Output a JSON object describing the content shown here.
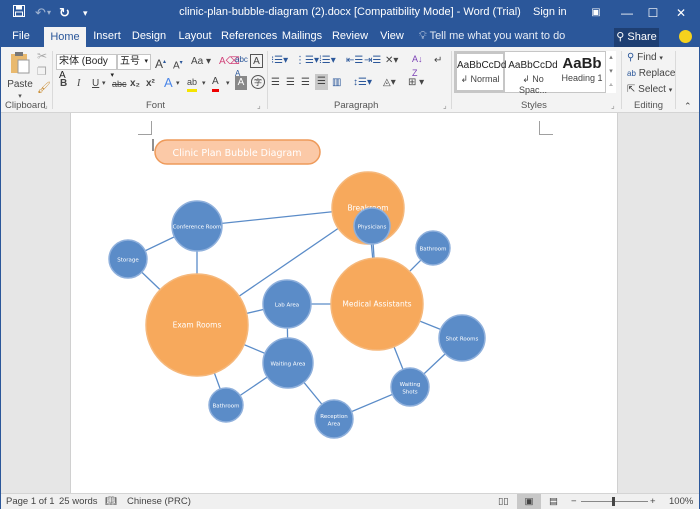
{
  "titlebar": {
    "title": "clinic-plan-bubble-diagram (2).docx [Compatibility Mode]  -  Word (Trial)",
    "sign_in": "Sign in",
    "quick_access": [
      "save-icon",
      "undo-icon",
      "redo-icon",
      "customize-icon"
    ],
    "window_controls": [
      "ribbon-display-icon",
      "minimize-icon",
      "maximize-icon",
      "close-icon"
    ]
  },
  "tabs": [
    {
      "label": "File"
    },
    {
      "label": "Home",
      "active": true
    },
    {
      "label": "Insert"
    },
    {
      "label": "Design"
    },
    {
      "label": "Layout"
    },
    {
      "label": "References"
    },
    {
      "label": "Mailings"
    },
    {
      "label": "Review"
    },
    {
      "label": "View"
    }
  ],
  "tell_me": "Tell me what you want to do",
  "share_label": "Share",
  "ribbon": {
    "clipboard": {
      "label": "Clipboard",
      "paste": "Paste"
    },
    "font": {
      "label": "Font",
      "font_name": "宋体 (Body A",
      "font_size": "五号",
      "buttons": [
        "B",
        "I",
        "U",
        "abc",
        "x₂",
        "x²"
      ]
    },
    "paragraph": {
      "label": "Paragraph"
    },
    "styles": {
      "label": "Styles",
      "items": [
        {
          "sample": "AaBbCcDd",
          "name": "↲ Normal"
        },
        {
          "sample": "AaBbCcDd",
          "name": "↲ No Spac..."
        },
        {
          "sample": "AaBb",
          "name": "Heading 1"
        }
      ]
    },
    "editing": {
      "label": "Editing",
      "find": "Find",
      "replace": "Replace",
      "select": "Select"
    }
  },
  "document": {
    "title_shape": "Clinic Plan Bubble Diagram",
    "colors": {
      "orange": "#f7a95c",
      "blue": "#5b8cc8",
      "title_fill": "#fbc9a7",
      "title_stroke": "#ee9a5a",
      "line": "#5b8cc8"
    },
    "bubbles": [
      {
        "id": "breakroom",
        "label": "Breakroom",
        "type": "major"
      },
      {
        "id": "conference",
        "label": "Conference Room",
        "type": "minor"
      },
      {
        "id": "storage",
        "label": "Storage",
        "type": "minor"
      },
      {
        "id": "physicians",
        "label": "Physicians",
        "type": "minor"
      },
      {
        "id": "bathroom1",
        "label": "Bathroom",
        "type": "minor"
      },
      {
        "id": "exam",
        "label": "Exam Rooms",
        "type": "major"
      },
      {
        "id": "lab",
        "label": "Lab Area",
        "type": "minor"
      },
      {
        "id": "medical",
        "label": "Medical Assistants",
        "type": "major"
      },
      {
        "id": "waiting",
        "label": "Waiting Area",
        "type": "minor"
      },
      {
        "id": "shot",
        "label": "Shot Rooms",
        "type": "minor"
      },
      {
        "id": "waitingshots",
        "label": "Waiting Shots",
        "type": "minor"
      },
      {
        "id": "bathroom2",
        "label": "Bathroom",
        "type": "minor"
      },
      {
        "id": "reception",
        "label": "Reception Area",
        "type": "minor"
      }
    ],
    "connections": [
      [
        "conference",
        "breakroom"
      ],
      [
        "storage",
        "conference"
      ],
      [
        "conference",
        "exam"
      ],
      [
        "storage",
        "exam"
      ],
      [
        "breakroom",
        "physicians"
      ],
      [
        "breakroom",
        "medical"
      ],
      [
        "breakroom",
        "exam"
      ],
      [
        "physicians",
        "medical"
      ],
      [
        "bathroom1",
        "medical"
      ],
      [
        "exam",
        "lab"
      ],
      [
        "lab",
        "medical"
      ],
      [
        "lab",
        "waiting"
      ],
      [
        "exam",
        "waiting"
      ],
      [
        "exam",
        "bathroom2"
      ],
      [
        "waiting",
        "bathroom2"
      ],
      [
        "waiting",
        "reception"
      ],
      [
        "reception",
        "waitingshots"
      ],
      [
        "waitingshots",
        "shot"
      ],
      [
        "medical",
        "shot"
      ],
      [
        "medical",
        "waitingshots"
      ]
    ]
  },
  "status": {
    "page": "Page 1 of 1",
    "words": "25 words",
    "language": "Chinese (PRC)",
    "zoom": "100%",
    "zoom_level_percent": 100
  }
}
